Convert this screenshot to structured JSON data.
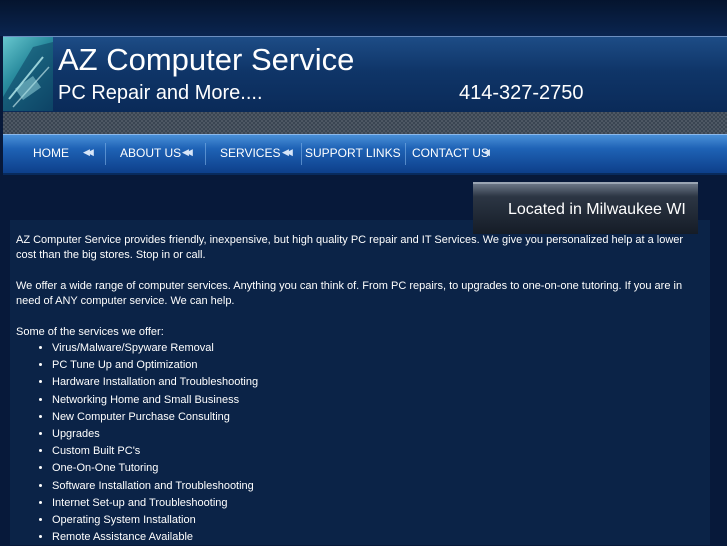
{
  "header": {
    "title": "AZ Computer Service",
    "tagline": "PC Repair and More....",
    "phone": "414-327-2750"
  },
  "nav": {
    "items": [
      {
        "label": "HOME"
      },
      {
        "label": "ABOUT US"
      },
      {
        "label": "SERVICES"
      },
      {
        "label": "SUPPORT LINKS"
      },
      {
        "label": "CONTACT US"
      }
    ]
  },
  "location": {
    "text": "Located in Milwaukee WI"
  },
  "main": {
    "paragraph1": "AZ Computer Service provides friendly, inexpensive, but high quality PC repair and IT Services.  We give you personalized help at a lower cost than the big stores.  Stop in or call.",
    "paragraph2": "We offer a wide range of computer services.  Anything you can think of.  From PC repairs, to upgrades to one-on-one tutoring.  If you are in need of ANY computer service.  We can help.",
    "services_intro": "Some of the services we offer:",
    "services": [
      "Virus/Malware/Spyware Removal",
      "PC Tune Up and Optimization",
      "Hardware Installation and Troubleshooting",
      "Networking Home and Small Business",
      "New Computer Purchase Consulting",
      "Upgrades",
      "Custom Built PC's",
      "One-On-One Tutoring",
      "Software Installation and Troubleshooting",
      "Internet Set-up and Troubleshooting",
      "Operating System Installation",
      "Remote Assistance Available"
    ]
  }
}
